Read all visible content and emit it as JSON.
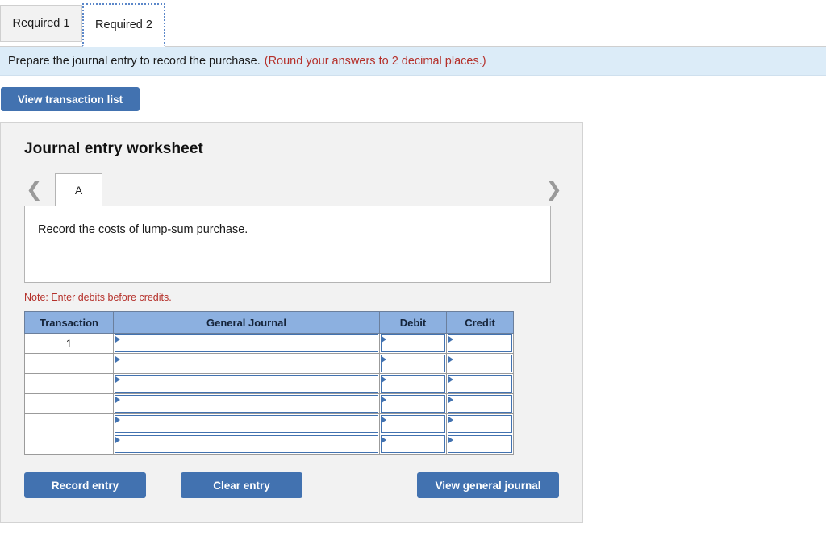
{
  "tabs": [
    {
      "label": "Required 1",
      "active": false
    },
    {
      "label": "Required 2",
      "active": true
    }
  ],
  "instruction": {
    "text": "Prepare the journal entry to record the purchase.",
    "note": "(Round your answers to 2 decimal places.)",
    "note_color": "#b5302a"
  },
  "toolbar": {
    "view_transaction_list": "View transaction list"
  },
  "worksheet": {
    "title": "Journal entry worksheet",
    "prev_icon": "chevron-left-icon",
    "next_icon": "chevron-right-icon",
    "entry_tabs": [
      {
        "label": "A",
        "active": true
      }
    ],
    "description": "Record the costs of lump-sum purchase.",
    "note": "Note: Enter debits before credits."
  },
  "table": {
    "headers": [
      "Transaction",
      "General Journal",
      "Debit",
      "Credit"
    ],
    "rows": [
      {
        "transaction": "1",
        "general_journal": "",
        "debit": "",
        "credit": ""
      },
      {
        "transaction": "",
        "general_journal": "",
        "debit": "",
        "credit": ""
      },
      {
        "transaction": "",
        "general_journal": "",
        "debit": "",
        "credit": ""
      },
      {
        "transaction": "",
        "general_journal": "",
        "debit": "",
        "credit": ""
      },
      {
        "transaction": "",
        "general_journal": "",
        "debit": "",
        "credit": ""
      },
      {
        "transaction": "",
        "general_journal": "",
        "debit": "",
        "credit": ""
      }
    ]
  },
  "actions": {
    "record_entry": "Record entry",
    "clear_entry": "Clear entry",
    "view_general_journal": "View general journal"
  },
  "colors": {
    "button_blue": "#4272b0",
    "header_blue": "#8cb0e0",
    "instruction_bg": "#dcecf8",
    "panel_bg": "#f2f2f2",
    "note_red": "#b5302a"
  }
}
